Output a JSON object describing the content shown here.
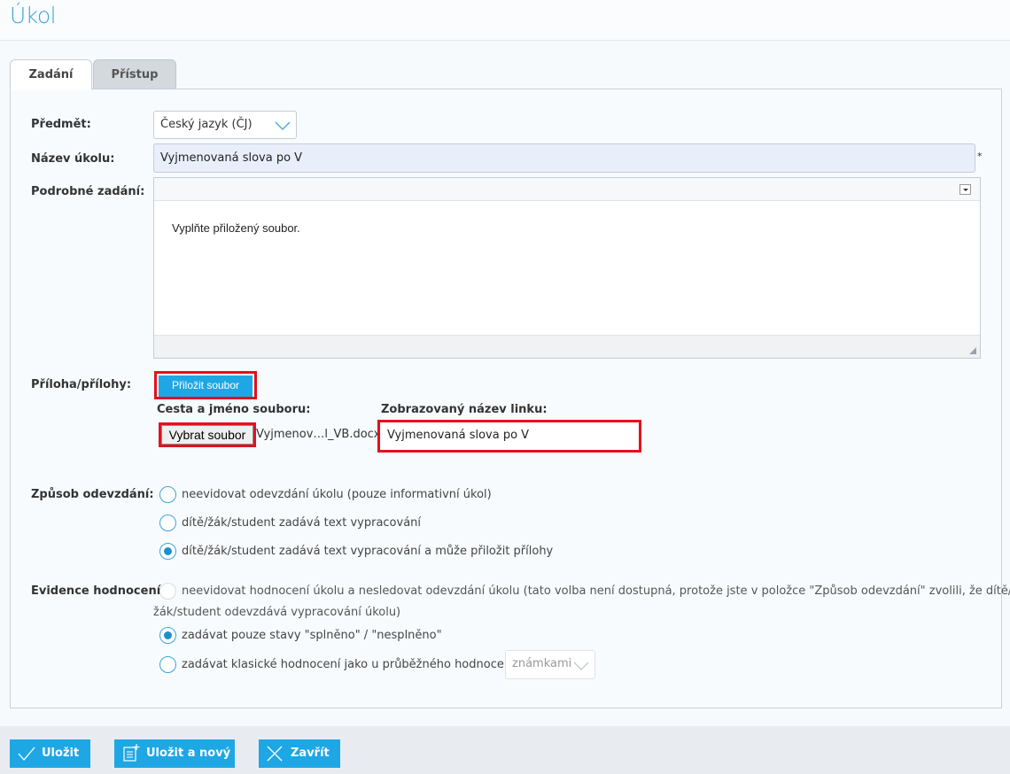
{
  "page": {
    "title": "Úkol"
  },
  "tabs": [
    {
      "label": "Zadání",
      "active": true
    },
    {
      "label": "Přístup",
      "active": false
    }
  ],
  "form": {
    "subject": {
      "label": "Předmět:",
      "value": "Český jazyk (ČJ)"
    },
    "task_name": {
      "label": "Název úkolu:",
      "value": "Vyjmenovaná slova po V",
      "required_mark": "*"
    },
    "detail": {
      "label": "Podrobné zadání:",
      "text": "Vyplňte přiložený soubor."
    },
    "attachments": {
      "label": "Příloha/přílohy:",
      "attach_button": "Přiložit soubor",
      "path_label": "Cesta a jméno souboru:",
      "link_label": "Zobrazovaný název linku:",
      "choose_button": "Vybrat soubor",
      "file_name": "Vyjmenov…l_VB.docx",
      "link_value": "Vyjmenovaná slova po V"
    },
    "submission": {
      "label": "Způsob odevzdání:",
      "options": [
        {
          "text": "neevidovat odevzdání úkolu (pouze informativní úkol)",
          "checked": false
        },
        {
          "text": "dítě/žák/student zadává text vypracování",
          "checked": false
        },
        {
          "text": "dítě/žák/student zadává text vypracování a může přiložit přílohy",
          "checked": true
        }
      ]
    },
    "evaluation": {
      "label": "Evidence hodnocení:",
      "options": [
        {
          "text": "neevidovat hodnocení úkolu a nesledovat odevzdání úkolu (tato volba není dostupná, protože jste v položce \"Způsob odevzdání\" zvolili, že dítě/",
          "text_line2": "žák/student odevzdává vypracování úkolu)",
          "checked": false,
          "disabled": true
        },
        {
          "text": "zadávat pouze stavy \"splněno\" / \"nesplněno\"",
          "checked": true
        },
        {
          "text": "zadávat klasické hodnocení jako u průběžného hodnocení a to",
          "checked": false
        }
      ],
      "grade_select": "známkami"
    }
  },
  "footer": {
    "save": "Uložit",
    "save_new": "Uložit a nový",
    "close": "Zavřít"
  },
  "colors": {
    "accent": "#1ea7e4",
    "title": "#3aa5d8",
    "highlight_frame": "#e3101d"
  }
}
